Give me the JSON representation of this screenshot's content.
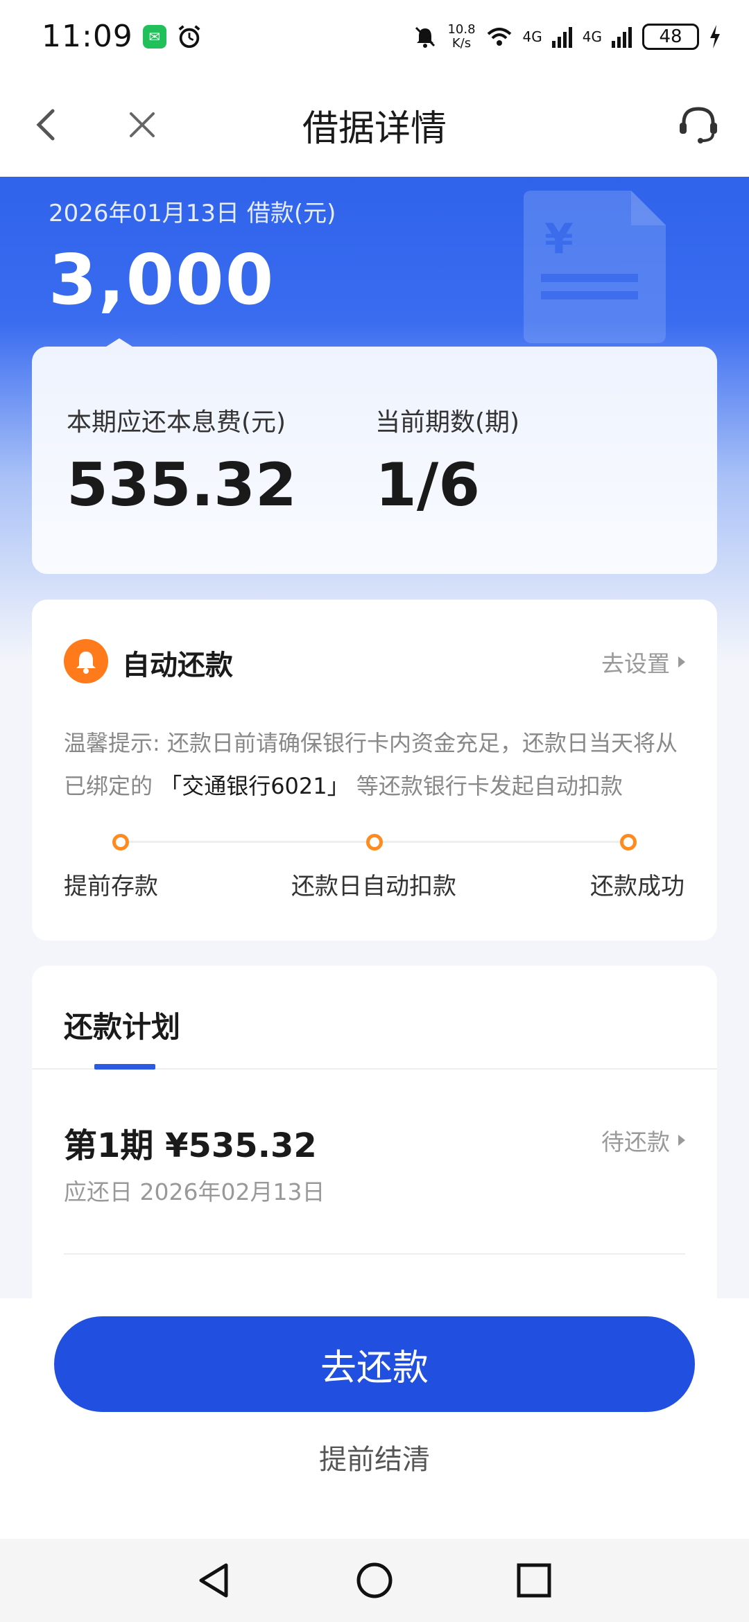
{
  "status_bar": {
    "time": "11:09",
    "net_speed_value": "10.8",
    "net_speed_unit": "K/s",
    "signal1": "4G",
    "signal2": "4G",
    "battery": "48"
  },
  "nav": {
    "title": "借据详情"
  },
  "hero": {
    "date_label": "2026年01月13日 借款(元)",
    "amount": "3,000",
    "doc_symbol": "¥"
  },
  "summary": {
    "due_label": "本期应还本息费(元)",
    "due_value": "535.32",
    "period_label": "当前期数(期)",
    "period_value": "1/6"
  },
  "auto_repay": {
    "title": "自动还款",
    "setting_link": "去设置",
    "tip_prefix": "温馨提示: 还款日前请确保银行卡内资金充足，还款日当天将从已绑定的",
    "bank": "「交通银行6021」",
    "tip_suffix": "等还款银行卡发起自动扣款",
    "steps": [
      "提前存款",
      "还款日自动扣款",
      "还款成功"
    ]
  },
  "plan": {
    "tab": "还款计划",
    "rows": [
      {
        "title": "第1期 ¥535.32",
        "status": "待还款",
        "due_date": "应还日 2026年02月13日"
      }
    ]
  },
  "actions": {
    "repay": "去还款",
    "settle": "提前结清"
  },
  "colors": {
    "primary": "#2150e0",
    "accent_orange": "#ff7a1a",
    "hero_blue": "#2f63ea"
  },
  "icons": [
    "back-icon",
    "close-icon",
    "customer-service-icon",
    "bell-icon",
    "document-icon",
    "chevron-right-icon",
    "system-back-icon",
    "system-home-icon",
    "system-recents-icon"
  ]
}
